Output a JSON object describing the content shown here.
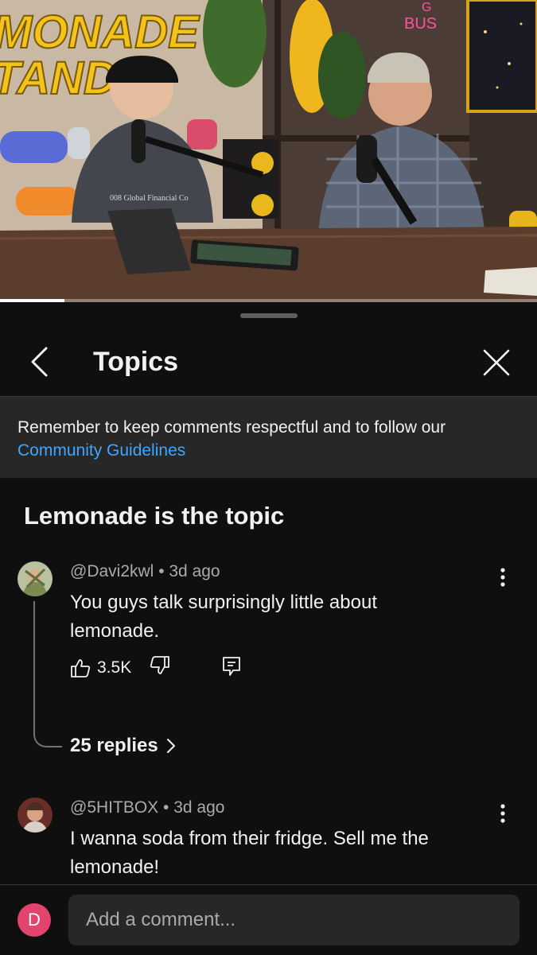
{
  "video": {
    "progress_fraction": 0.12,
    "sign_text": "MONADE\nSTAND",
    "shirt_text": "008 Global Financial Co",
    "neon_text": "G BUS"
  },
  "sheet": {
    "title": "Topics",
    "guidelines_text": "Remember to keep comments respectful and to follow our",
    "guidelines_link": "Community Guidelines",
    "topic_heading": "Lemonade is the topic"
  },
  "comments": [
    {
      "author": "@Davi2kwl",
      "age": "3d ago",
      "text": "You guys talk surprisingly little about lemonade.",
      "likes": "3.5K",
      "replies": "25 replies"
    },
    {
      "author": "@5HITBOX",
      "age": "3d ago",
      "text": "I wanna soda from their fridge. Sell me the lemonade!"
    }
  ],
  "footer": {
    "user_initial": "D",
    "placeholder": "Add a comment..."
  },
  "colors": {
    "link": "#3ea6ff",
    "user_avatar": "#e2446d"
  },
  "icons": [
    "chevron-left-icon",
    "close-icon",
    "more-vert-icon",
    "thumb-up-icon",
    "thumb-down-icon",
    "reply-icon",
    "chevron-right-icon"
  ]
}
